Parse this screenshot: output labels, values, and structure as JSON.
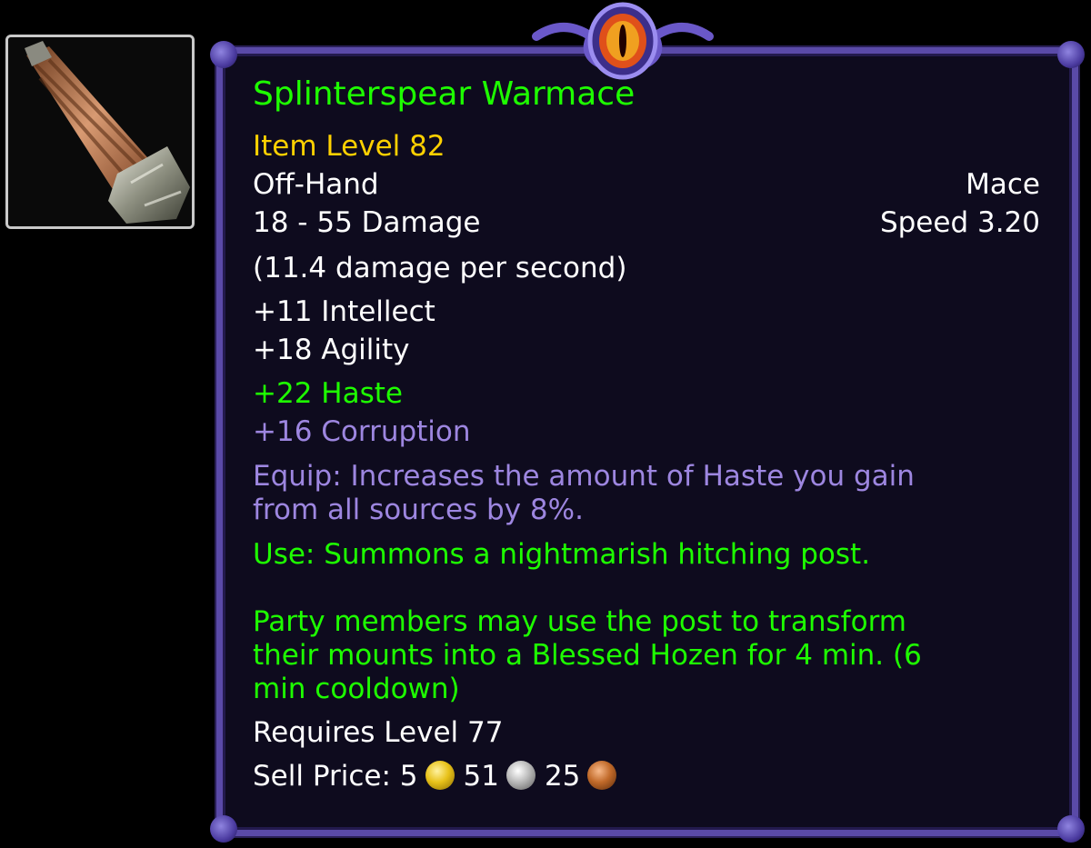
{
  "item": {
    "name": "Splinterspear Warmace",
    "item_level": "Item Level 82",
    "slot": "Off-Hand",
    "type": "Mace",
    "damage": "18 - 55 Damage",
    "speed": "Speed 3.20",
    "dps": "(11.4 damage per second)",
    "stats": [
      "+11 Intellect",
      "+18 Agility"
    ],
    "bonus_stat": "+22 Haste",
    "corruption": "+16 Corruption",
    "equip_lines": [
      "Equip: Increases the amount of Haste you gain",
      "from all sources by 8%."
    ],
    "use_lines": [
      "Use: Summons a nightmarish hitching post.",
      "Party members may use the post to transform",
      "their mounts into a Blessed Hozen for 4 min. (6",
      "min cooldown)"
    ],
    "requires": "Requires Level 77",
    "sell_price": {
      "label": "Sell Price: ",
      "gold": "5",
      "silver": "51",
      "copper": "25"
    }
  },
  "colors": {
    "name": "#1eff00",
    "item_level": "#ffd100",
    "corruption": "#9d86e0",
    "frame": "#5a4aa8"
  },
  "icons": [
    "mace-item-icon",
    "eye-ornament-icon",
    "gold-coin-icon",
    "silver-coin-icon",
    "copper-coin-icon"
  ]
}
